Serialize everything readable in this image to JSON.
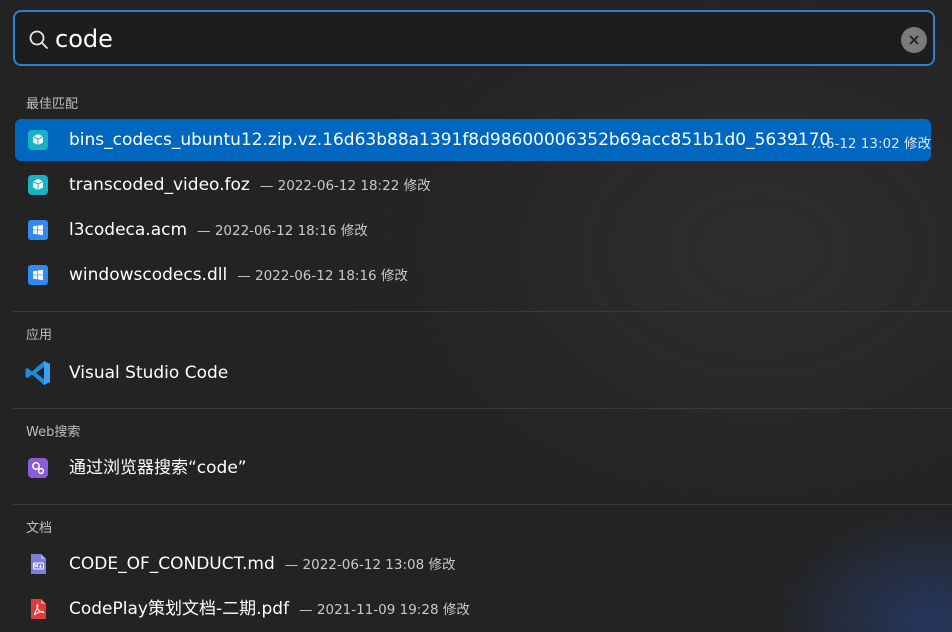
{
  "search": {
    "query": "code"
  },
  "sections": {
    "best_match": "最佳匹配",
    "apps": "应用",
    "web": "Web搜索",
    "docs": "文档"
  },
  "best_match_items": [
    {
      "name": "bins_codecs_ubuntu12.zip.vz.16d63b88a1391f8d98600006352b69acc851b1d0_5639170",
      "meta": "— …6-12 13:02 修改",
      "icon": "package-icon"
    },
    {
      "name": "transcoded_video.foz",
      "meta": "— 2022-06-12 18:22 修改",
      "icon": "package-icon"
    },
    {
      "name": "l3codeca.acm",
      "meta": "— 2022-06-12 18:16 修改",
      "icon": "windows-file-icon"
    },
    {
      "name": "windowscodecs.dll",
      "meta": "— 2022-06-12 18:16 修改",
      "icon": "windows-file-icon"
    }
  ],
  "apps_items": [
    {
      "name": "Visual Studio Code",
      "icon": "vscode-icon"
    }
  ],
  "web_items": [
    {
      "name": "通过浏览器搜索“code”",
      "icon": "browser-search-icon"
    }
  ],
  "docs_items": [
    {
      "name": "CODE_OF_CONDUCT.md",
      "meta": "— 2022-06-12 13:08 修改",
      "icon": "markdown-file-icon"
    },
    {
      "name": "CodePlay策划文档-二期.pdf",
      "meta": "— 2021-11-09 19:28 修改",
      "icon": "pdf-file-icon"
    }
  ],
  "colors": {
    "accent": "#0067c0",
    "search_border": "#2d7fd0",
    "background": "#232323"
  }
}
